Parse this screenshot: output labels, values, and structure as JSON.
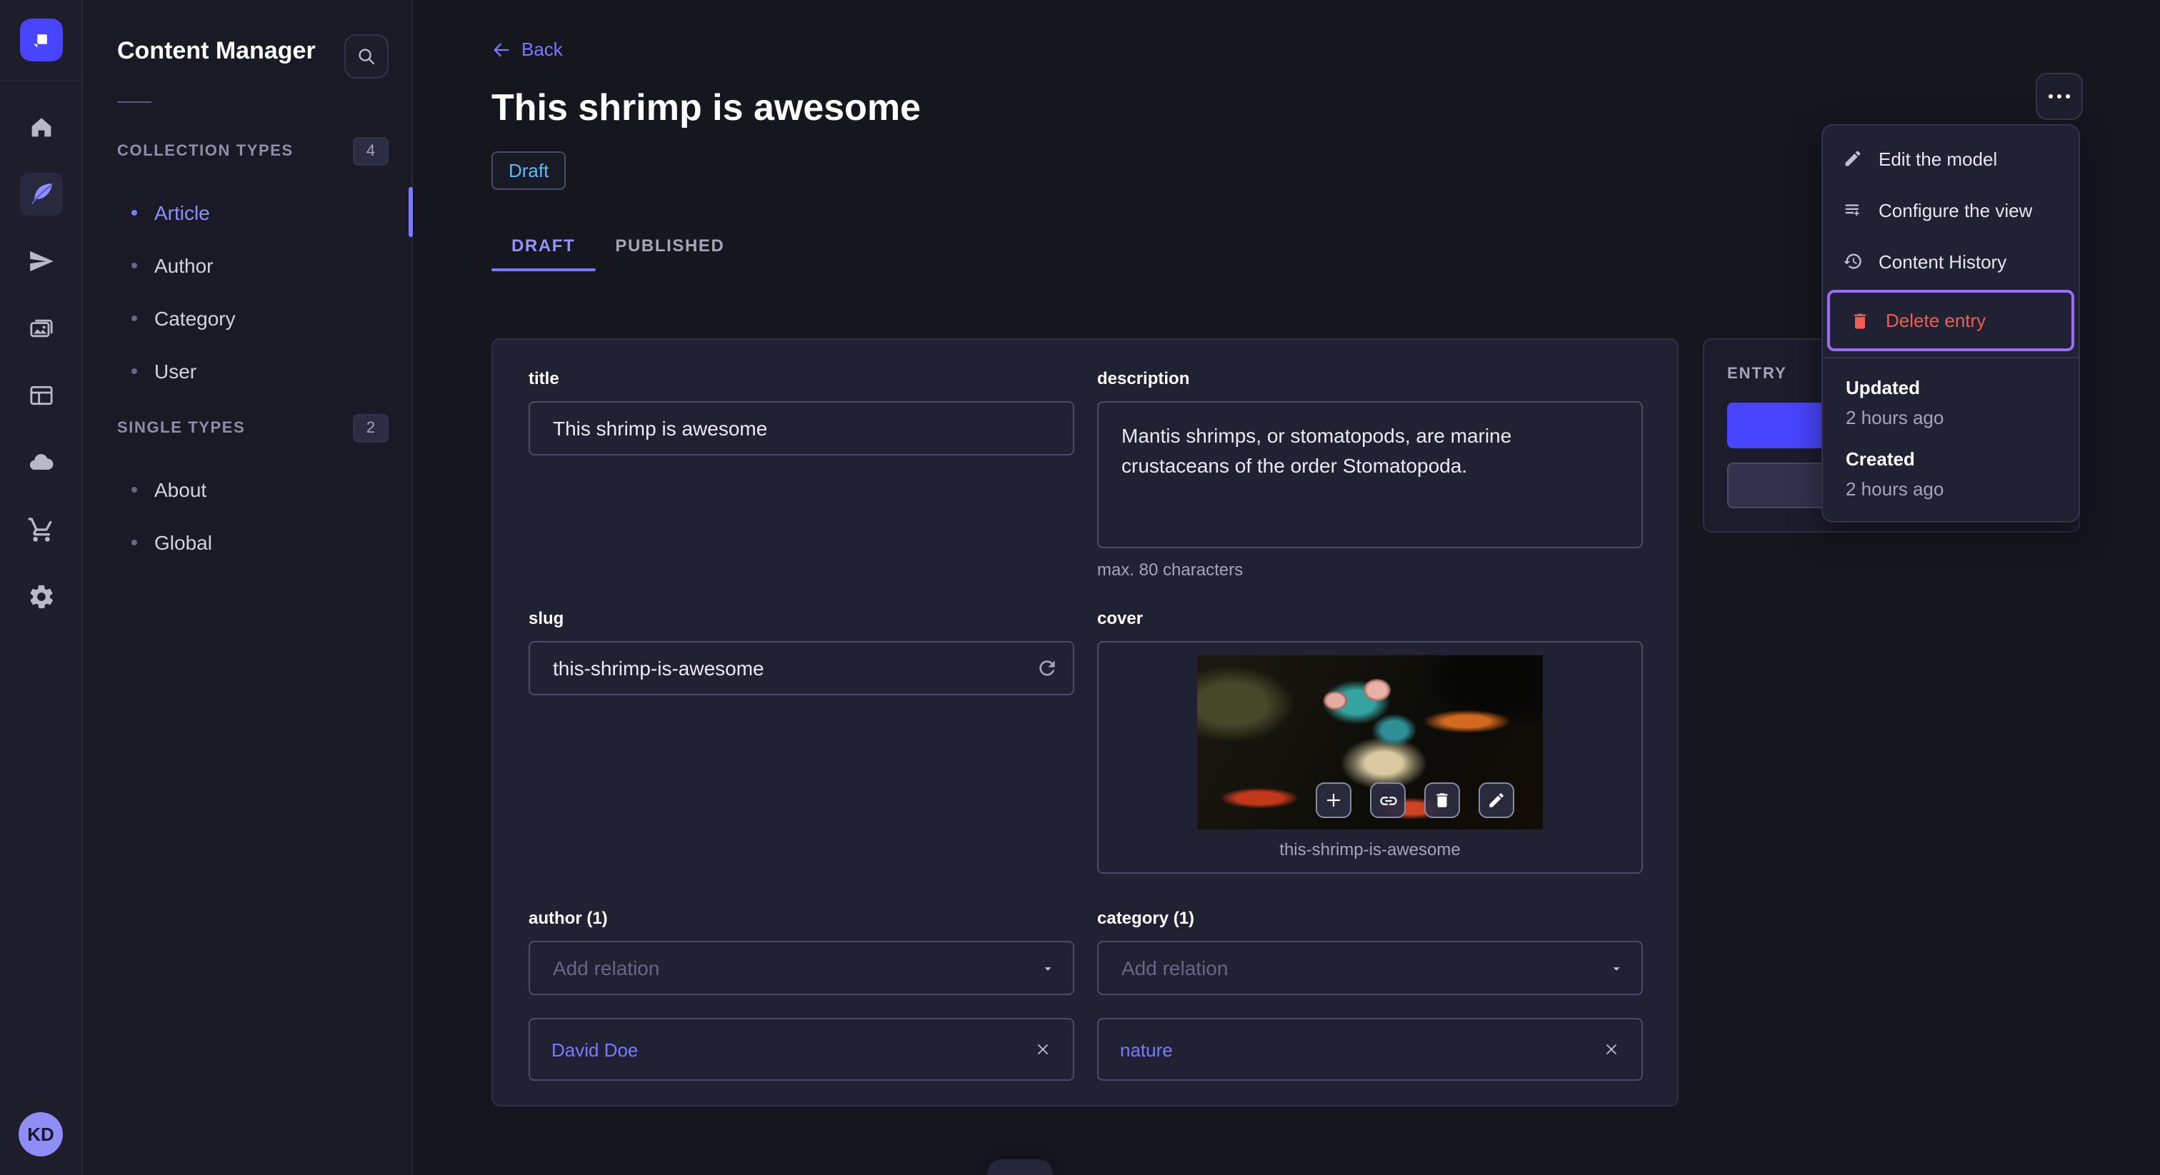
{
  "sidebar": {
    "title": "Content Manager",
    "sections": [
      {
        "label": "COLLECTION TYPES",
        "badge": "4",
        "items": [
          {
            "label": "Article"
          },
          {
            "label": "Author"
          },
          {
            "label": "Category"
          },
          {
            "label": "User"
          }
        ]
      },
      {
        "label": "SINGLE TYPES",
        "badge": "2",
        "items": [
          {
            "label": "About"
          },
          {
            "label": "Global"
          }
        ]
      }
    ],
    "avatar_initials": "KD"
  },
  "rail_icons": [
    "strapi-logo",
    "home",
    "feather-content",
    "paper-plane",
    "media-library",
    "content-type-builder",
    "cloud",
    "marketplace-cart",
    "settings-gear"
  ],
  "header": {
    "back_label": "Back",
    "title": "This shrimp is awesome",
    "status_badge": "Draft",
    "tabs": {
      "draft": "DRAFT",
      "published": "PUBLISHED"
    }
  },
  "form": {
    "title": {
      "label": "title",
      "value": "This shrimp is awesome"
    },
    "description": {
      "label": "description",
      "value": "Mantis shrimps, or stomatopods, are marine crustaceans of the order Stomatopoda.",
      "hint": "max. 80 characters"
    },
    "slug": {
      "label": "slug",
      "value": "this-shrimp-is-awesome"
    },
    "cover": {
      "label": "cover",
      "caption": "this-shrimp-is-awesome"
    },
    "author": {
      "label": "author (1)",
      "placeholder": "Add relation",
      "relation": "David Doe"
    },
    "category": {
      "label": "category (1)",
      "placeholder": "Add relation",
      "relation": "nature"
    }
  },
  "entry_panel": {
    "label": "ENTRY"
  },
  "menu": {
    "items": [
      {
        "label": "Edit the model"
      },
      {
        "label": "Configure the view"
      },
      {
        "label": "Content History"
      },
      {
        "label": "Delete entry"
      }
    ],
    "meta": [
      {
        "label": "Updated",
        "value": "2 hours ago"
      },
      {
        "label": "Created",
        "value": "2 hours ago"
      }
    ]
  },
  "colors": {
    "primary": "#4945ff",
    "primary_light": "#7b79ff",
    "danger": "#ee5e52",
    "draft_status": "#66b7f1",
    "focus_ring": "#9b6df3",
    "panel_bg": "#212134",
    "page_bg": "#16161f"
  }
}
